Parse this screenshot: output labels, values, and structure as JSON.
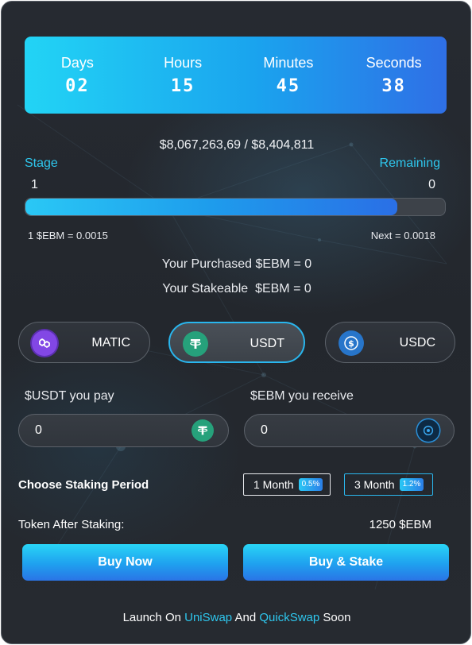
{
  "countdown": {
    "days_label": "Days",
    "days": "02",
    "hours_label": "Hours",
    "hours": "15",
    "minutes_label": "Minutes",
    "minutes": "45",
    "seconds_label": "Seconds",
    "seconds": "38"
  },
  "raised": {
    "text": "$8,067,263,69 / $8,404,811",
    "progress": 0.886
  },
  "stage": {
    "label": "Stage",
    "value": "1"
  },
  "remaining": {
    "label": "Remaining",
    "value": "0"
  },
  "price": {
    "current": "1 $EBM = 0.0015",
    "next": "Next = 0.0018"
  },
  "balances": {
    "purchased": "Your Purchased $EBM = 0",
    "stakeable": "Your Stakeable  $EBM = 0"
  },
  "tokens": [
    {
      "name": "MATIC",
      "icon": "polygon-icon",
      "color": "#8247e5",
      "active": false
    },
    {
      "name": "USDT",
      "icon": "tether-icon",
      "color": "#26a17b",
      "active": true
    },
    {
      "name": "USDC",
      "icon": "usdc-icon",
      "color": "#2775ca",
      "active": false
    }
  ],
  "pay": {
    "label": "$USDT you pay",
    "value": "0",
    "icon": "tether-icon"
  },
  "receive": {
    "label": "$EBM you receive",
    "value": "0",
    "icon": "ebm-token-icon"
  },
  "staking": {
    "title": "Choose Staking Period",
    "periods": [
      {
        "label": "1 Month",
        "rate": "0.5%"
      },
      {
        "label": "3 Month",
        "rate": "1.2%"
      }
    ],
    "selected": "3 Month"
  },
  "after_staking": {
    "label": "Token After Staking:",
    "value": "1250 $EBM"
  },
  "buttons": {
    "buy_now": "Buy Now",
    "buy_stake": "Buy & Stake"
  },
  "launch": {
    "prefix": "Launch On ",
    "link1": "UniSwap",
    "middle": " And ",
    "link2": "QuickSwap",
    "suffix": " Soon"
  },
  "colors": {
    "accent": "#2ec7ee",
    "background": "#24282e",
    "gradient_start": "#22d4f5",
    "gradient_end": "#2f6fe6"
  }
}
